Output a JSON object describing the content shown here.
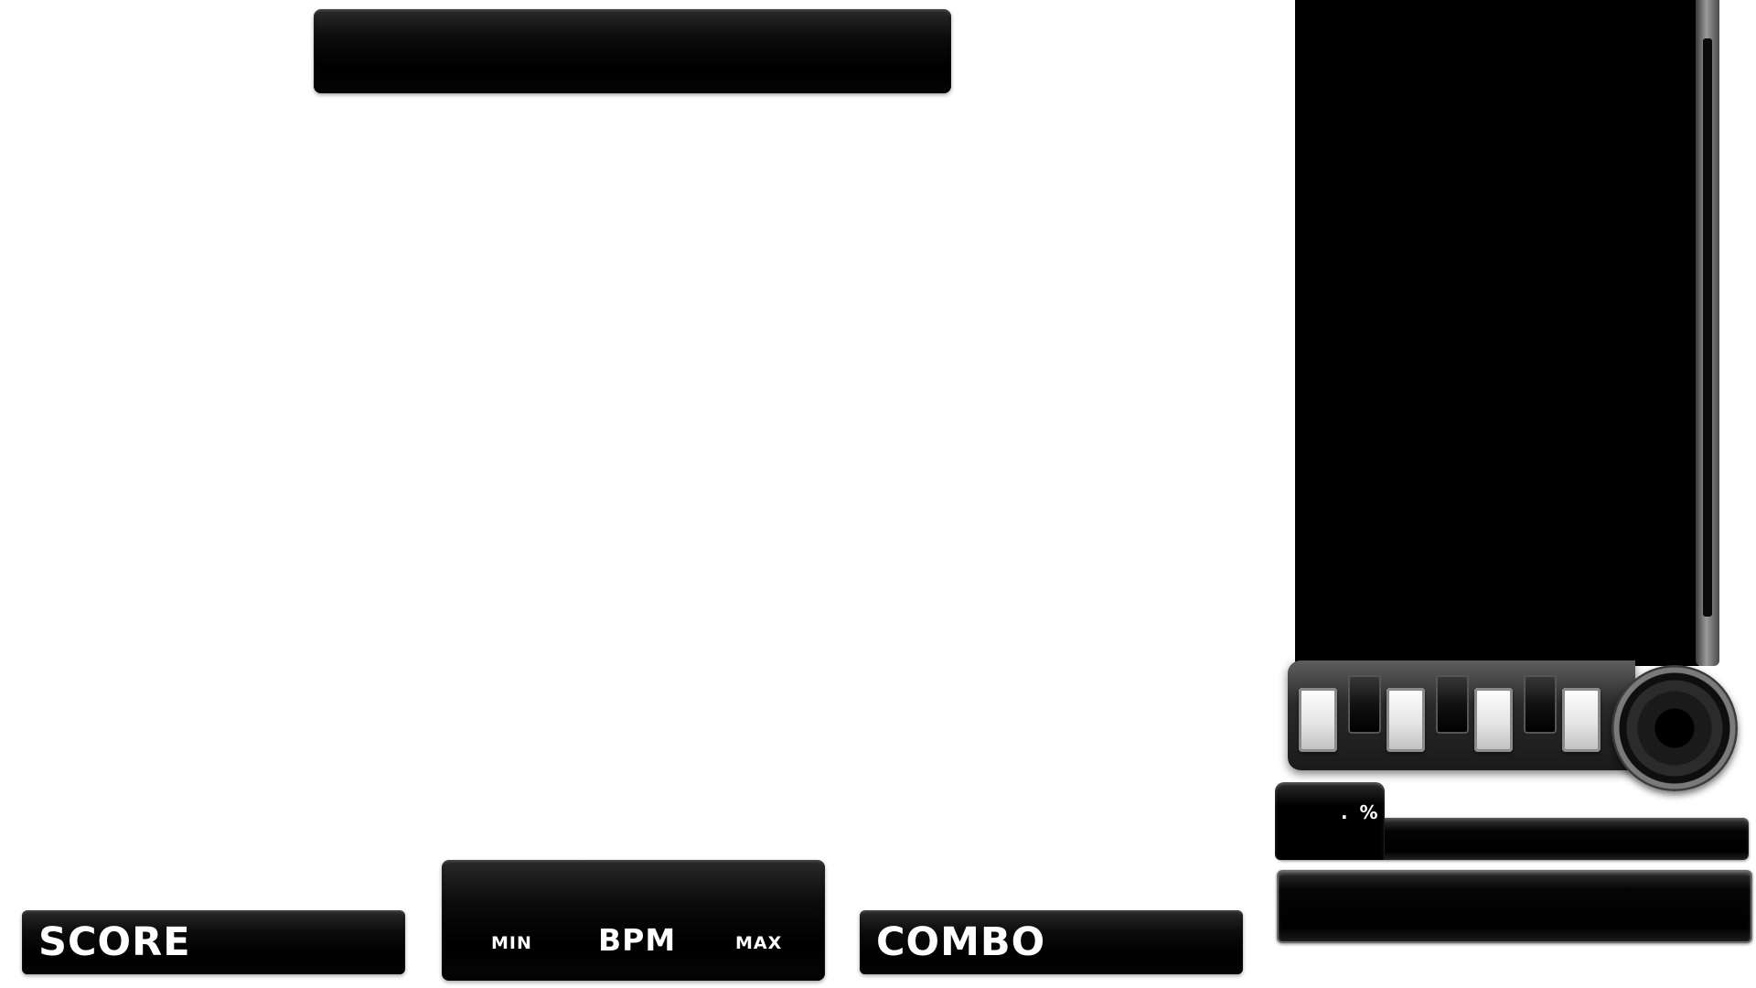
{
  "hud": {
    "score_label": "SCORE",
    "bpm_min_label": "MIN",
    "bpm_label": "BPM",
    "bpm_max_label": "MAX",
    "combo_label": "COMBO"
  },
  "gauge": {
    "percent_text": ". %"
  },
  "controller": {
    "keys": [
      "white",
      "black",
      "white",
      "black",
      "white",
      "black",
      "white"
    ],
    "icons": {
      "turntable": "turntable-icon"
    }
  }
}
